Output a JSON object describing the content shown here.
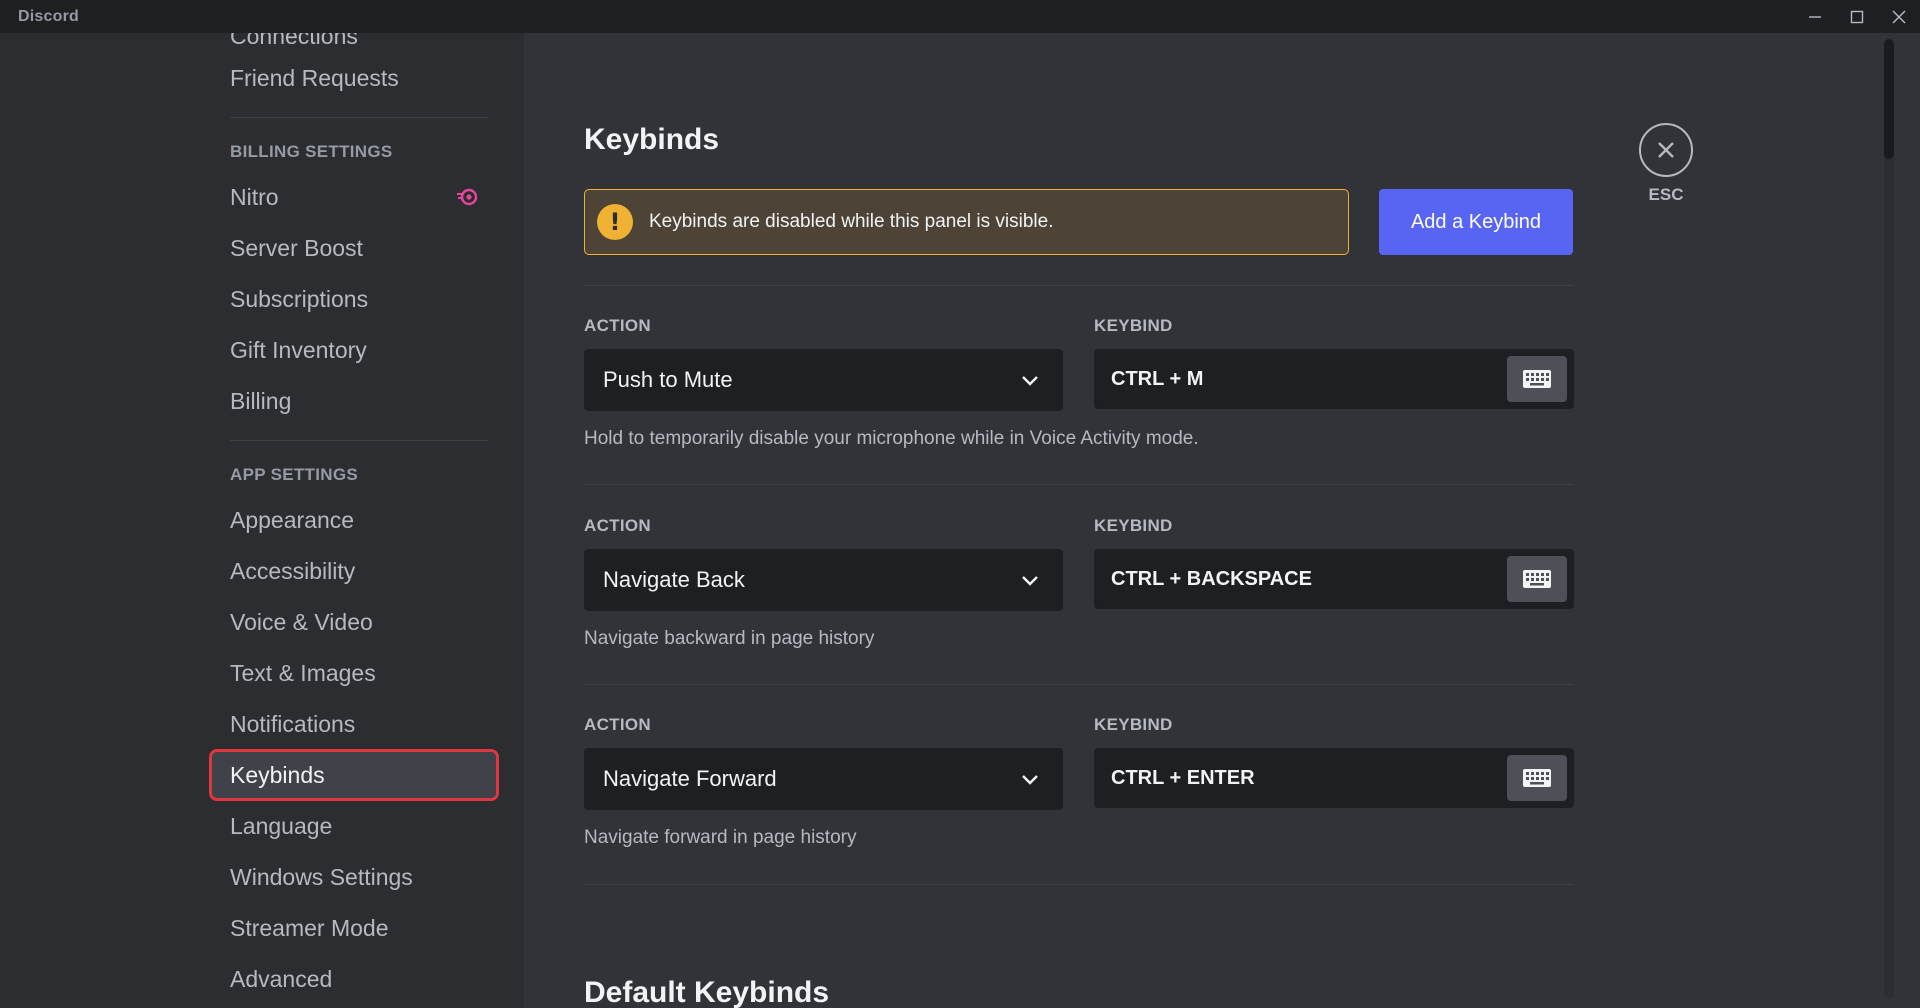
{
  "app": {
    "title": "Discord"
  },
  "sidebar": {
    "partial_top_item": "Connections",
    "items_user": [
      "Friend Requests"
    ],
    "billing_header": "BILLING SETTINGS",
    "billing_items": [
      "Nitro",
      "Server Boost",
      "Subscriptions",
      "Gift Inventory",
      "Billing"
    ],
    "app_header": "APP SETTINGS",
    "app_items": [
      "Appearance",
      "Accessibility",
      "Voice & Video",
      "Text & Images",
      "Notifications",
      "Keybinds",
      "Language",
      "Windows Settings",
      "Streamer Mode",
      "Advanced"
    ],
    "selected": "Keybinds"
  },
  "main": {
    "title": "Keybinds",
    "warning": "Keybinds are disabled while this panel is visible.",
    "add_button": "Add a Keybind",
    "close_label": "ESC",
    "action_label": "ACTION",
    "keybind_label": "KEYBIND",
    "keybinds": [
      {
        "action": "Push to Mute",
        "keybind": "CTRL + M",
        "description": "Hold to temporarily disable your microphone while in Voice Activity mode."
      },
      {
        "action": "Navigate Back",
        "keybind": "CTRL + BACKSPACE",
        "description": "Navigate backward in page history"
      },
      {
        "action": "Navigate Forward",
        "keybind": "CTRL + ENTER",
        "description": "Navigate forward in page history"
      }
    ],
    "default_section_title": "Default Keybinds"
  },
  "colors": {
    "accent": "#5865f2",
    "warning": "#f0b232",
    "selection_outline": "#e0373e",
    "nitro": "#eb459f"
  }
}
